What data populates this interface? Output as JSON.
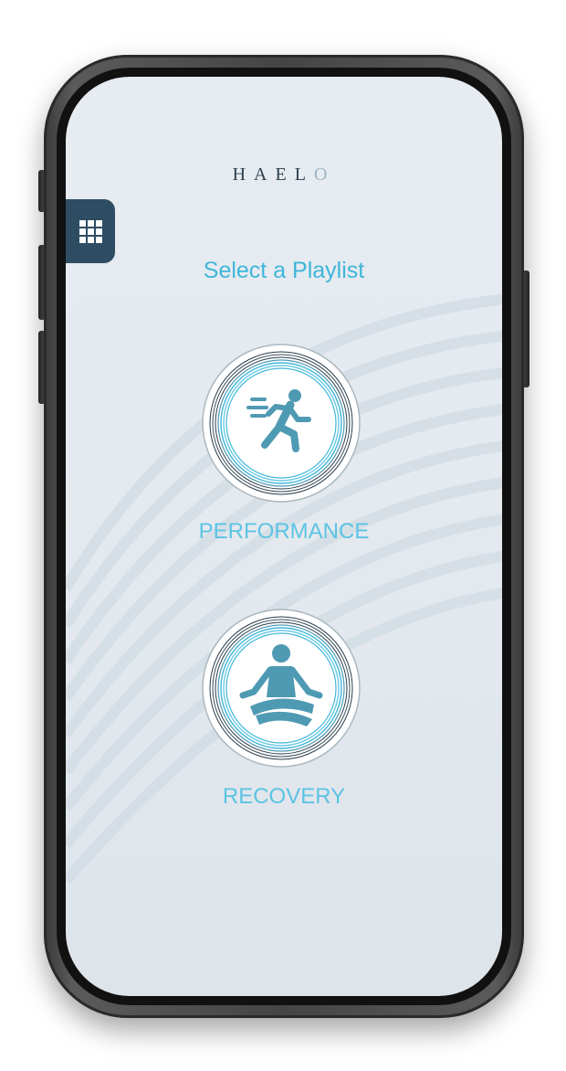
{
  "app": {
    "logo_main": "HAEL",
    "logo_accent": "O"
  },
  "header": {
    "title": "Select a Playlist",
    "menu_icon": "grid-icon"
  },
  "playlists": [
    {
      "label": "PERFORMANCE",
      "icon": "running-person-icon"
    },
    {
      "label": "RECOVERY",
      "icon": "meditation-person-icon"
    }
  ],
  "colors": {
    "accent": "#3fb6d9",
    "label": "#5cc3e3",
    "icon_fill": "#4f9ab3",
    "menu_bg": "#2e4d63",
    "logo": "#2c3e4c"
  }
}
